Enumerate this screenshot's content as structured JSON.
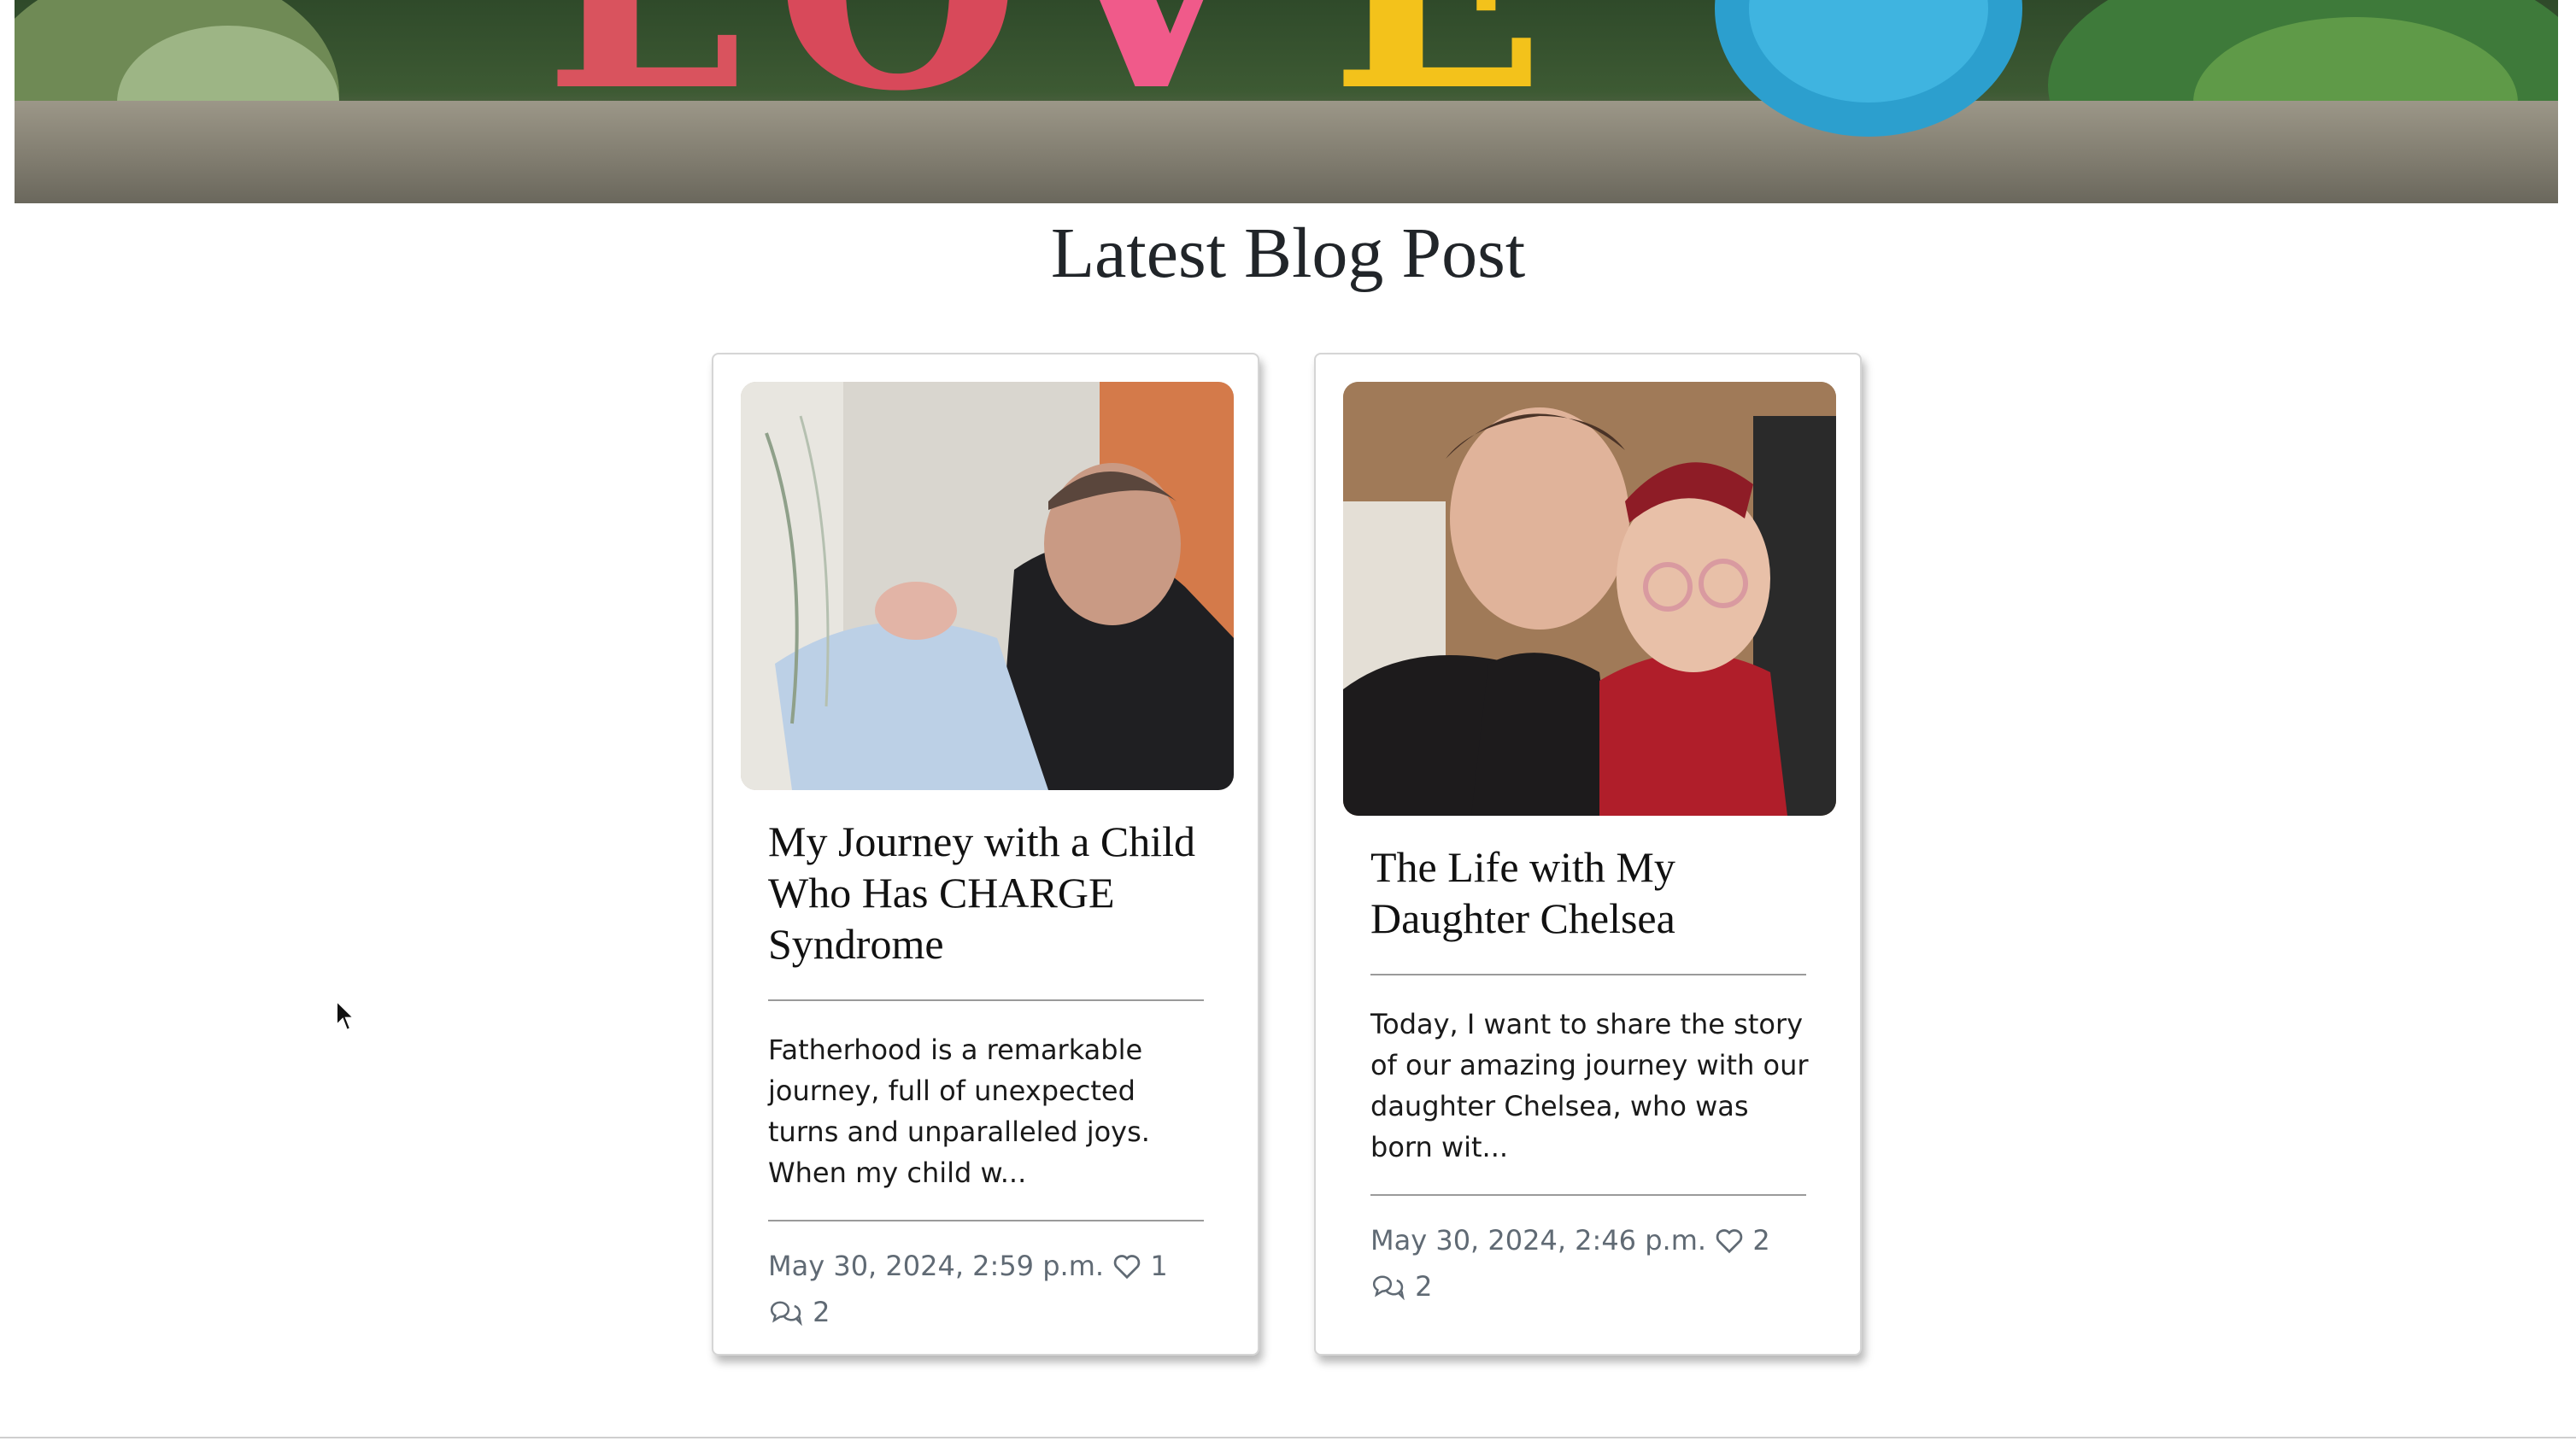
{
  "hero": {
    "letters": [
      "L",
      "O",
      "V",
      "E"
    ]
  },
  "page": {
    "title": "Latest Blog Post"
  },
  "posts": [
    {
      "title": "My Journey with a Child Who Has CHARGE Syndrome",
      "excerpt": "Fatherhood is a remarkable journey, full of unexpected turns and unparalleled joys. When my child w...",
      "date": "May 30, 2024, 2:59 p.m.",
      "likes": "1",
      "comments": "2",
      "image_icon": "father-holding-newborn-photo"
    },
    {
      "title": "The Life with My Daughter Chelsea",
      "excerpt": "Today, I want to share the story of our amazing journey with our daughter Chelsea, who was born wit...",
      "date": "May 30, 2024, 2:46 p.m.",
      "likes": "2",
      "comments": "2",
      "image_icon": "mother-and-daughter-photo"
    }
  ],
  "colors": {
    "meta_text": "#606a74",
    "title_text": "#212529",
    "card_border": "#d5d5d5"
  }
}
